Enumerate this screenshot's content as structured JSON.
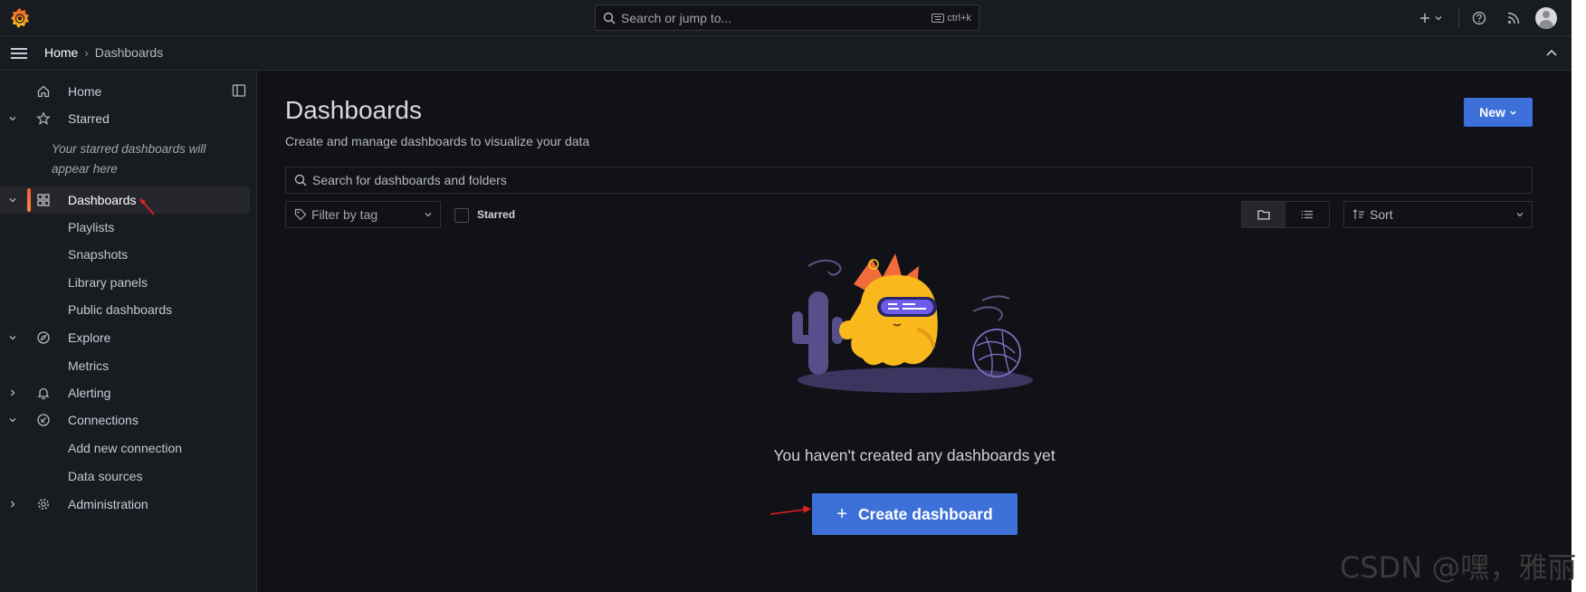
{
  "topbar": {
    "search_placeholder": "Search or jump to...",
    "search_shortcut": "ctrl+k"
  },
  "breadcrumb": {
    "home": "Home",
    "separator": "›",
    "current": "Dashboards"
  },
  "sidebar": {
    "items": [
      {
        "label": "Home"
      },
      {
        "label": "Starred"
      },
      {
        "label": "Dashboards"
      },
      {
        "label": "Playlists"
      },
      {
        "label": "Snapshots"
      },
      {
        "label": "Library panels"
      },
      {
        "label": "Public dashboards"
      },
      {
        "label": "Explore"
      },
      {
        "label": "Metrics"
      },
      {
        "label": "Alerting"
      },
      {
        "label": "Connections"
      },
      {
        "label": "Add new connection"
      },
      {
        "label": "Data sources"
      },
      {
        "label": "Administration"
      }
    ],
    "starred_hint": "Your starred dashboards will appear here",
    "active_item": "Dashboards"
  },
  "main": {
    "title": "Dashboards",
    "subtitle": "Create and manage dashboards to visualize your data",
    "new_button": "New",
    "search_placeholder": "Search for dashboards and folders",
    "filter_by_tag": "Filter by tag",
    "starred_label": "Starred",
    "sort_label": "Sort",
    "empty_message": "You haven't created any dashboards yet",
    "create_button": "Create dashboard",
    "create_icon": "+"
  },
  "watermark": "CSDN @嘿，雅丽",
  "colors": {
    "background": "#111217",
    "panel": "#181b1f",
    "primary_button": "#3d71d9",
    "active_accent": "#f55f3e",
    "annotation_arrow": "#e02020"
  }
}
